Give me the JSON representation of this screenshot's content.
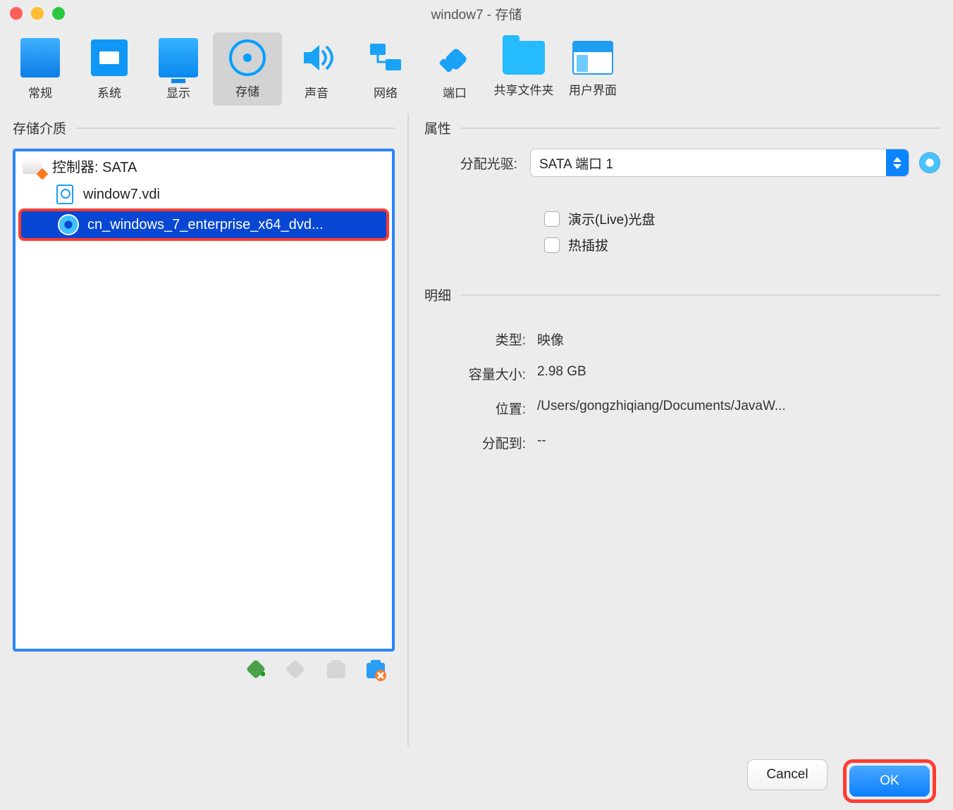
{
  "window": {
    "title": "window7 - 存储"
  },
  "toolbar": {
    "tabs": [
      {
        "id": "general",
        "label": "常规"
      },
      {
        "id": "system",
        "label": "系统"
      },
      {
        "id": "display",
        "label": "显示"
      },
      {
        "id": "storage",
        "label": "存储",
        "selected": true
      },
      {
        "id": "audio",
        "label": "声音"
      },
      {
        "id": "network",
        "label": "网络"
      },
      {
        "id": "ports",
        "label": "端口"
      },
      {
        "id": "sharedfolders",
        "label": "共享文件夹"
      },
      {
        "id": "ui",
        "label": "用户界面"
      }
    ]
  },
  "left": {
    "section_title": "存储介质",
    "controller_label": "控制器: SATA",
    "items": [
      {
        "name": "window7.vdi",
        "type": "hdd"
      },
      {
        "name": "cn_windows_7_enterprise_x64_dvd...",
        "type": "cd",
        "selected": true
      }
    ],
    "toolbar": {
      "add_controller": "add-controller",
      "remove_controller": "remove-controller",
      "add_attachment": "add-attachment",
      "remove_attachment": "remove-attachment"
    }
  },
  "right": {
    "section_attributes": "属性",
    "optical_drive_label": "分配光驱:",
    "optical_drive_value": "SATA 端口 1",
    "live_cd_label": "演示(Live)光盘",
    "hotplug_label": "热插拔",
    "section_details": "明细",
    "details": {
      "type_label": "类型:",
      "type_value": "映像",
      "size_label": "容量大小:",
      "size_value": "2.98 GB",
      "location_label": "位置:",
      "location_value": "/Users/gongzhiqiang/Documents/JavaW...",
      "attached_label": "分配到:",
      "attached_value": "--"
    }
  },
  "footer": {
    "cancel": "Cancel",
    "ok": "OK"
  }
}
